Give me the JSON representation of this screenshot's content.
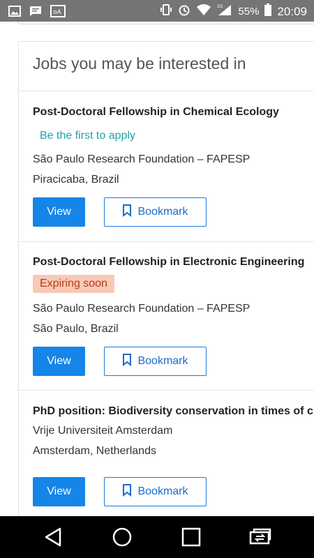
{
  "status_bar": {
    "battery_percent": "55%",
    "time": "20:09",
    "network": "2G"
  },
  "section": {
    "title": "Jobs you may be interested in"
  },
  "jobs": [
    {
      "title": "Post-Doctoral Fellowship in Chemical Ecology",
      "badge": "Be the first to apply",
      "badge_type": "apply",
      "employer": "São Paulo Research Foundation – FAPESP",
      "location": "Piracicaba, Brazil",
      "view_label": "View",
      "bookmark_label": "Bookmark"
    },
    {
      "title": "Post-Doctoral Fellowship in Electronic Engineering",
      "badge": "Expiring soon",
      "badge_type": "expiring",
      "employer": "São Paulo Research Foundation – FAPESP",
      "location": "São Paulo, Brazil",
      "view_label": "View",
      "bookmark_label": "Bookmark"
    },
    {
      "title": "PhD position: Biodiversity conservation in times of c",
      "employer": "Vrije Universiteit Amsterdam",
      "location": "Amsterdam, Netherlands",
      "view_label": "View",
      "bookmark_label": "Bookmark"
    }
  ],
  "colors": {
    "primary": "#1585e8",
    "apply_badge": "#23a0a8",
    "expiring_bg": "#f8c9b5",
    "expiring_text": "#b43b1d",
    "status_bar": "#757575"
  }
}
